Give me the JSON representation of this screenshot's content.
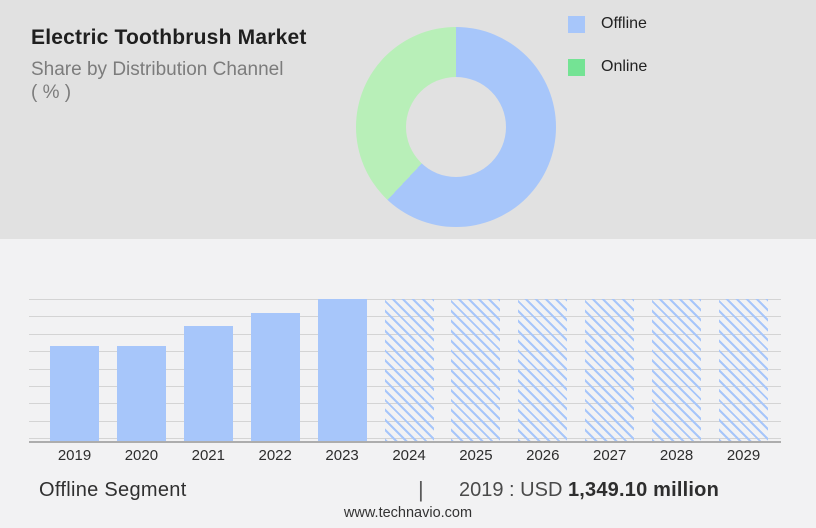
{
  "header": {
    "title": "Electric Toothbrush Market",
    "subtitle": "Share by Distribution Channel",
    "unit_line": "( % )"
  },
  "legend": [
    {
      "label": "Offline",
      "color": "#a7c6fa"
    },
    {
      "label": "Online",
      "color": "#74e394"
    }
  ],
  "colors": {
    "top_bg": "#e1e1e1",
    "bottom_bg": "#f2f2f3",
    "bar_blue": "#a7c6fa",
    "donut_blue": "#a7c6fa",
    "donut_green": "#b8efb8",
    "gridline": "#d4d4d4",
    "axis": "#adadad"
  },
  "chart_data": [
    {
      "type": "pie",
      "subtype": "donut",
      "title": "Share by Distribution Channel ( % )",
      "labels": [
        "Offline",
        "Online"
      ],
      "values_pct": [
        62,
        38
      ],
      "colors": [
        "#a7c6fa",
        "#b8efb8"
      ],
      "start_angle_deg": 0,
      "direction": "clockwise",
      "legend_position": "right"
    },
    {
      "type": "bar",
      "title": "Offline Segment",
      "categories": [
        "2019",
        "2020",
        "2021",
        "2022",
        "2023",
        "2024",
        "2025",
        "2026",
        "2027",
        "2028",
        "2029"
      ],
      "values_relative": [
        0.67,
        0.67,
        0.81,
        0.9,
        1.0,
        1.0,
        1.0,
        1.0,
        1.0,
        1.0,
        1.0
      ],
      "bar_styles": [
        "solid",
        "solid",
        "solid",
        "solid",
        "solid",
        "hatched",
        "hatched",
        "hatched",
        "hatched",
        "hatched",
        "hatched"
      ],
      "known_values": {
        "2019": "USD 1,349.10 million"
      },
      "forecast_years_hatched": [
        "2024",
        "2025",
        "2026",
        "2027",
        "2028",
        "2029"
      ],
      "xlabel": "",
      "ylabel": "",
      "grid": true,
      "gridline_count": 9,
      "y_axis_labels_shown": false
    }
  ],
  "footer": {
    "segment_label": "Offline Segment",
    "separator": "|",
    "value_prefix": "2019 : USD",
    "value_bold": "1,349.10 million",
    "website": "www.technavio.com"
  }
}
